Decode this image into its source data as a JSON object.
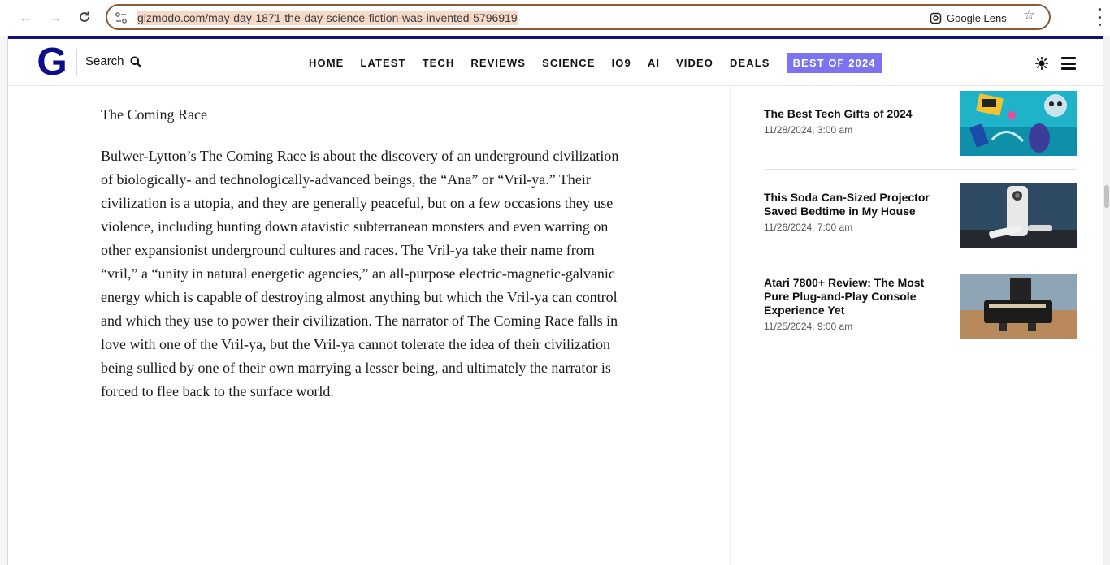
{
  "browser": {
    "url": "gizmodo.com/may-day-1871-the-day-science-fiction-was-invented-5796919",
    "lens_label": "Google Lens"
  },
  "site": {
    "logo": "G",
    "search_label": "Search",
    "nav": [
      "HOME",
      "LATEST",
      "TECH",
      "REVIEWS",
      "SCIENCE",
      "IO9",
      "AI",
      "VIDEO",
      "DEALS"
    ],
    "badge": "BEST OF 2024",
    "colors": {
      "brand": "#0d0d8a",
      "badge": "#7b73f0"
    }
  },
  "article": {
    "subhead": "The Coming Race",
    "body": "Bulwer-Lytton’s The Coming Race is about the discovery of an underground civilization of biologically- and technologically-advanced beings, the “Ana” or “Vril-ya.” Their civilization is a utopia, and they are generally peaceful, but on a few occasions they use violence, including hunting down atavistic subterranean monsters and even warring on other expansionist underground cultures and races. The Vril-ya take their name from “vril,” a “unity in natural energetic agencies,” an all-purpose electric-magnetic-galvanic energy which is capable of destroying almost anything but which the Vril-ya can control and which they use to power their civilization. The narrator of The Coming Race falls in love with one of the Vril-ya, but the Vril-ya cannot tolerate the idea of their civilization being sullied by one of their own marrying a lesser being, and ultimately the narrator is forced to flee back to the surface world."
  },
  "sidebar": {
    "items": [
      {
        "title": "The Best Tech Gifts of 2024",
        "date": "11/28/2024, 3:00 am"
      },
      {
        "title": "This Soda Can-Sized Projector Saved Bedtime in My House",
        "date": "11/26/2024, 7:00 am"
      },
      {
        "title": "Atari 7800+ Review: The Most Pure Plug-and-Play Console Experience Yet",
        "date": "11/25/2024, 9:00 am"
      }
    ]
  }
}
